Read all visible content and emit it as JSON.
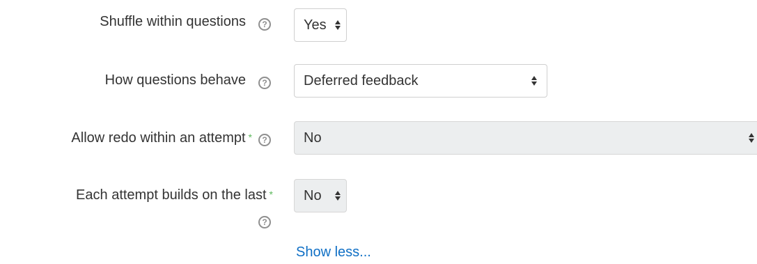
{
  "fields": {
    "shuffle": {
      "label": "Shuffle within questions",
      "help_glyph": "?",
      "value": "Yes"
    },
    "behaviour": {
      "label": "How questions behave",
      "help_glyph": "?",
      "value": "Deferred feedback"
    },
    "redo": {
      "label": "Allow redo within an attempt",
      "required_mark": "*",
      "help_glyph": "?",
      "value": "No"
    },
    "builds": {
      "label": "Each attempt builds on the last",
      "required_mark": "*",
      "help_glyph": "?",
      "value": "No"
    }
  },
  "show_less": "Show less...",
  "colors": {
    "label": "#333333",
    "required": "#5cb85c",
    "link": "#0f6fc5",
    "disabled_bg": "#eceeef",
    "border": "#cfcfcf"
  },
  "icons": {
    "help": "question-circle-icon",
    "select_arrows": "sort-arrows-icon"
  }
}
